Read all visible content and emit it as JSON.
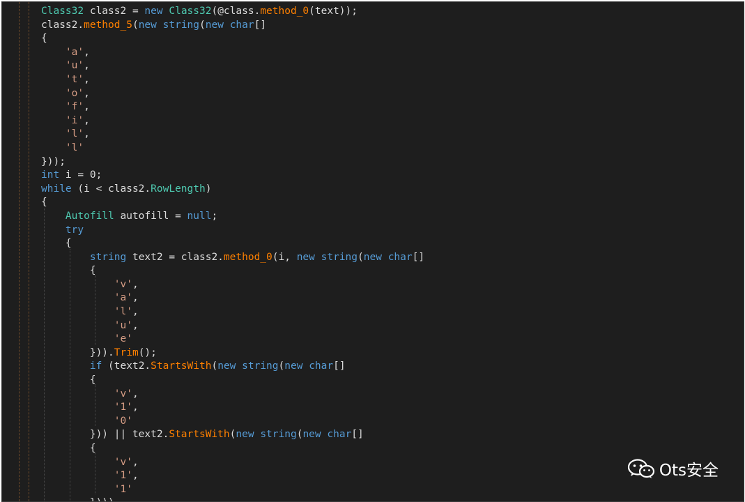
{
  "watermark": {
    "text": "Ots安全",
    "icon": "wechat-icon"
  },
  "colors": {
    "background": "#1e1e1e",
    "keyword": "#569cd6",
    "type": "#4ec9b0",
    "method": "#ff8000",
    "string": "#d69d85",
    "plain": "#dcdcdc"
  },
  "code_lines": [
    [
      [
        "ty",
        "Class32"
      ],
      [
        "tx",
        " class2 = "
      ],
      [
        "kw",
        "new"
      ],
      [
        "tx",
        " "
      ],
      [
        "ty",
        "Class32"
      ],
      [
        "tx",
        "(@class."
      ],
      [
        "mt",
        "method_0"
      ],
      [
        "tx",
        "(text));"
      ]
    ],
    [
      [
        "tx",
        "class2."
      ],
      [
        "mt",
        "method_5"
      ],
      [
        "tx",
        "("
      ],
      [
        "kw",
        "new"
      ],
      [
        "tx",
        " "
      ],
      [
        "kw",
        "string"
      ],
      [
        "tx",
        "("
      ],
      [
        "kw",
        "new"
      ],
      [
        "tx",
        " "
      ],
      [
        "kw",
        "char"
      ],
      [
        "tx",
        "[]"
      ]
    ],
    [
      [
        "tx",
        "{"
      ]
    ],
    [
      [
        "tx",
        "    "
      ],
      [
        "st",
        "'a'"
      ],
      [
        "tx",
        ","
      ]
    ],
    [
      [
        "tx",
        "    "
      ],
      [
        "st",
        "'u'"
      ],
      [
        "tx",
        ","
      ]
    ],
    [
      [
        "tx",
        "    "
      ],
      [
        "st",
        "'t'"
      ],
      [
        "tx",
        ","
      ]
    ],
    [
      [
        "tx",
        "    "
      ],
      [
        "st",
        "'o'"
      ],
      [
        "tx",
        ","
      ]
    ],
    [
      [
        "tx",
        "    "
      ],
      [
        "st",
        "'f'"
      ],
      [
        "tx",
        ","
      ]
    ],
    [
      [
        "tx",
        "    "
      ],
      [
        "st",
        "'i'"
      ],
      [
        "tx",
        ","
      ]
    ],
    [
      [
        "tx",
        "    "
      ],
      [
        "st",
        "'l'"
      ],
      [
        "tx",
        ","
      ]
    ],
    [
      [
        "tx",
        "    "
      ],
      [
        "st",
        "'l'"
      ]
    ],
    [
      [
        "tx",
        "}));"
      ]
    ],
    [
      [
        "kw",
        "int"
      ],
      [
        "tx",
        " i = 0;"
      ]
    ],
    [
      [
        "kw",
        "while"
      ],
      [
        "tx",
        " (i < class2."
      ],
      [
        "pr",
        "RowLength"
      ],
      [
        "tx",
        ")"
      ]
    ],
    [
      [
        "tx",
        "{"
      ]
    ],
    [
      [
        "tx",
        "    "
      ],
      [
        "ty",
        "Autofill"
      ],
      [
        "tx",
        " autofill = "
      ],
      [
        "kw",
        "null"
      ],
      [
        "tx",
        ";"
      ]
    ],
    [
      [
        "tx",
        "    "
      ],
      [
        "kw",
        "try"
      ]
    ],
    [
      [
        "tx",
        "    {"
      ]
    ],
    [
      [
        "tx",
        "        "
      ],
      [
        "kw",
        "string"
      ],
      [
        "tx",
        " text2 = class2."
      ],
      [
        "mt",
        "method_0"
      ],
      [
        "tx",
        "(i, "
      ],
      [
        "kw",
        "new"
      ],
      [
        "tx",
        " "
      ],
      [
        "kw",
        "string"
      ],
      [
        "tx",
        "("
      ],
      [
        "kw",
        "new"
      ],
      [
        "tx",
        " "
      ],
      [
        "kw",
        "char"
      ],
      [
        "tx",
        "[]"
      ]
    ],
    [
      [
        "tx",
        "        {"
      ]
    ],
    [
      [
        "tx",
        "            "
      ],
      [
        "st",
        "'v'"
      ],
      [
        "tx",
        ","
      ]
    ],
    [
      [
        "tx",
        "            "
      ],
      [
        "st",
        "'a'"
      ],
      [
        "tx",
        ","
      ]
    ],
    [
      [
        "tx",
        "            "
      ],
      [
        "st",
        "'l'"
      ],
      [
        "tx",
        ","
      ]
    ],
    [
      [
        "tx",
        "            "
      ],
      [
        "st",
        "'u'"
      ],
      [
        "tx",
        ","
      ]
    ],
    [
      [
        "tx",
        "            "
      ],
      [
        "st",
        "'e'"
      ]
    ],
    [
      [
        "tx",
        "        }))."
      ],
      [
        "mt",
        "Trim"
      ],
      [
        "tx",
        "();"
      ]
    ],
    [
      [
        "tx",
        "        "
      ],
      [
        "kw",
        "if"
      ],
      [
        "tx",
        " (text2."
      ],
      [
        "mt",
        "StartsWith"
      ],
      [
        "tx",
        "("
      ],
      [
        "kw",
        "new"
      ],
      [
        "tx",
        " "
      ],
      [
        "kw",
        "string"
      ],
      [
        "tx",
        "("
      ],
      [
        "kw",
        "new"
      ],
      [
        "tx",
        " "
      ],
      [
        "kw",
        "char"
      ],
      [
        "tx",
        "[]"
      ]
    ],
    [
      [
        "tx",
        "        {"
      ]
    ],
    [
      [
        "tx",
        "            "
      ],
      [
        "st",
        "'v'"
      ],
      [
        "tx",
        ","
      ]
    ],
    [
      [
        "tx",
        "            "
      ],
      [
        "st",
        "'1'"
      ],
      [
        "tx",
        ","
      ]
    ],
    [
      [
        "tx",
        "            "
      ],
      [
        "st",
        "'0'"
      ]
    ],
    [
      [
        "tx",
        "        })) || text2."
      ],
      [
        "mt",
        "StartsWith"
      ],
      [
        "tx",
        "("
      ],
      [
        "kw",
        "new"
      ],
      [
        "tx",
        " "
      ],
      [
        "kw",
        "string"
      ],
      [
        "tx",
        "("
      ],
      [
        "kw",
        "new"
      ],
      [
        "tx",
        " "
      ],
      [
        "kw",
        "char"
      ],
      [
        "tx",
        "[]"
      ]
    ],
    [
      [
        "tx",
        "        {"
      ]
    ],
    [
      [
        "tx",
        "            "
      ],
      [
        "st",
        "'v'"
      ],
      [
        "tx",
        ","
      ]
    ],
    [
      [
        "tx",
        "            "
      ],
      [
        "st",
        "'1'"
      ],
      [
        "tx",
        ","
      ]
    ],
    [
      [
        "tx",
        "            "
      ],
      [
        "st",
        "'1'"
      ]
    ],
    [
      [
        "tx",
        "        })))"
      ]
    ]
  ]
}
